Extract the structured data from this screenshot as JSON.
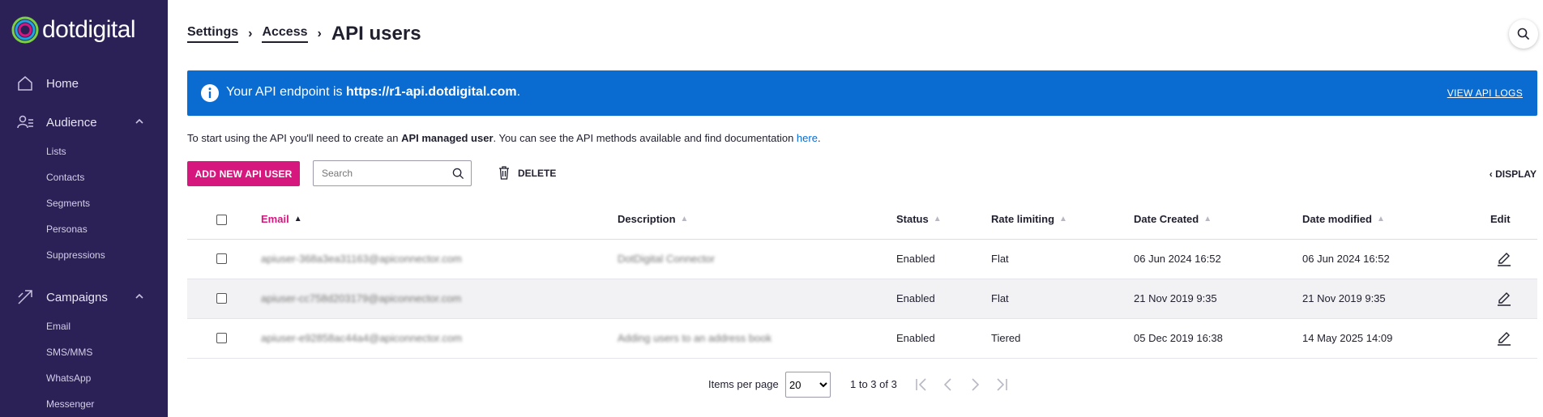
{
  "app": {
    "logo_text": "dotdigital"
  },
  "sidebar": {
    "items": [
      {
        "label": "Home",
        "icon": "home-icon"
      },
      {
        "label": "Audience",
        "icon": "audience-icon",
        "sub": [
          "Lists",
          "Contacts",
          "Segments",
          "Personas",
          "Suppressions"
        ]
      },
      {
        "label": "Campaigns",
        "icon": "campaigns-icon",
        "sub": [
          "Email",
          "SMS/MMS",
          "WhatsApp",
          "Messenger"
        ]
      }
    ]
  },
  "breadcrumb": {
    "settings": "Settings",
    "access": "Access",
    "current": "API users"
  },
  "banner": {
    "prefix": "Your API endpoint is ",
    "endpoint": "https://r1-api.dotdigital.com",
    "suffix": ".",
    "link": "VIEW API LOGS"
  },
  "intro": {
    "part1": "To start using the API you'll need to create an ",
    "bold": "API managed user",
    "part2": ". You can see the API methods available and find documentation ",
    "link": "here",
    "part3": "."
  },
  "toolbar": {
    "add_label": "ADD NEW API USER",
    "search_placeholder": "Search",
    "delete_label": "DELETE",
    "display_label": "DISPLAY"
  },
  "table": {
    "headers": {
      "email": "Email",
      "description": "Description",
      "status": "Status",
      "rate": "Rate limiting",
      "created": "Date Created",
      "modified": "Date modified",
      "edit": "Edit"
    },
    "rows": [
      {
        "email": "apiuser-368a3ea31163@apiconnector.com",
        "description": "DotDigital Connector",
        "status": "Enabled",
        "rate": "Flat",
        "created": "06 Jun 2024 16:52",
        "modified": "06 Jun 2024 16:52"
      },
      {
        "email": "apiuser-cc758d203179@apiconnector.com",
        "description": "",
        "status": "Enabled",
        "rate": "Flat",
        "created": "21 Nov 2019 9:35",
        "modified": "21 Nov 2019 9:35"
      },
      {
        "email": "apiuser-e92858ac44a4@apiconnector.com",
        "description": "Adding users to an address book",
        "status": "Enabled",
        "rate": "Tiered",
        "created": "05 Dec 2019 16:38",
        "modified": "14 May 2025 14:09"
      }
    ]
  },
  "pager": {
    "items_label": "Items per page",
    "page_size": "20",
    "range": "1 to 3 of 3"
  },
  "colors": {
    "sidebar": "#2b2157",
    "banner": "#0a6cd0",
    "accent": "#d6187e"
  }
}
